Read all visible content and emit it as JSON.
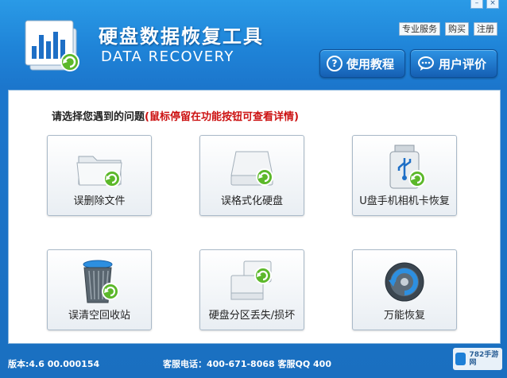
{
  "window": {
    "controls": [
      "–",
      "×"
    ]
  },
  "header": {
    "title_cn": "硬盘数据恢复工具",
    "title_en": "DATA RECOVERY",
    "links": [
      "专业服务",
      "购买",
      "注册"
    ],
    "tutorial_button": "使用教程",
    "review_button": "用户评价",
    "tutorial_icon": "?"
  },
  "main": {
    "prompt": "请选择您遇到的问题",
    "hint": "(鼠标停留在功能按钮可查看详情)",
    "tiles": [
      {
        "label": "误删除文件",
        "icon": "folder-icon"
      },
      {
        "label": "误格式化硬盘",
        "icon": "hard-drive-icon"
      },
      {
        "label": "U盘手机相机卡恢复",
        "icon": "usb-drive-icon"
      },
      {
        "label": "误清空回收站",
        "icon": "recycle-bin-icon"
      },
      {
        "label": "硬盘分区丢失/损坏",
        "icon": "partition-icon"
      },
      {
        "label": "万能恢复",
        "icon": "universal-recovery-icon"
      }
    ]
  },
  "status": {
    "version": "版本:4.6 00.000154",
    "contact": "客服电话：400-671-8068  客服QQ 400"
  },
  "watermark": {
    "text": "782手游网"
  },
  "colors": {
    "header_blue": "#1f84d8",
    "hint_red": "#cc1111",
    "arrow_green": "#5cb82a"
  }
}
